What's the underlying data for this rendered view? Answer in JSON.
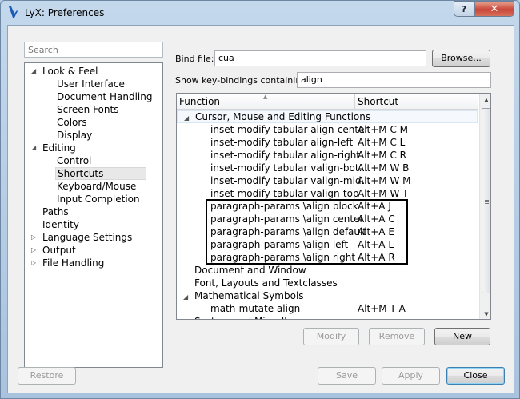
{
  "window": {
    "title": "LyX: Preferences",
    "help_glyph": "?",
    "close_glyph": "✕"
  },
  "search": {
    "placeholder": "Search"
  },
  "tree": [
    {
      "label": "Look & Feel",
      "level": 0,
      "expanded": true
    },
    {
      "label": "User Interface",
      "level": 1
    },
    {
      "label": "Document Handling",
      "level": 1
    },
    {
      "label": "Screen Fonts",
      "level": 1
    },
    {
      "label": "Colors",
      "level": 1
    },
    {
      "label": "Display",
      "level": 1
    },
    {
      "label": "Editing",
      "level": 0,
      "expanded": true
    },
    {
      "label": "Control",
      "level": 1
    },
    {
      "label": "Shortcuts",
      "level": 1,
      "selected": true
    },
    {
      "label": "Keyboard/Mouse",
      "level": 1
    },
    {
      "label": "Input Completion",
      "level": 1
    },
    {
      "label": "Paths",
      "level": 0
    },
    {
      "label": "Identity",
      "level": 0
    },
    {
      "label": "Language Settings",
      "level": 0,
      "collapsed": true
    },
    {
      "label": "Output",
      "level": 0,
      "collapsed": true
    },
    {
      "label": "File Handling",
      "level": 0,
      "collapsed": true
    }
  ],
  "bind_file": {
    "label": "Bind file:",
    "value": "cua",
    "browse_label": "Browse..."
  },
  "filter": {
    "label": "Show key-bindings containing:",
    "value": "align"
  },
  "table": {
    "columns": [
      "Function",
      "Shortcut"
    ],
    "rows": [
      {
        "fn": "Cursor, Mouse and Editing Functions",
        "sc": "",
        "level": 0,
        "expanded": true,
        "hl": true
      },
      {
        "fn": "inset-modify tabular align-center",
        "sc": "Alt+M C M",
        "level": 1
      },
      {
        "fn": "inset-modify tabular align-left",
        "sc": "Alt+M C L",
        "level": 1
      },
      {
        "fn": "inset-modify tabular align-right",
        "sc": "Alt+M C R",
        "level": 1
      },
      {
        "fn": "inset-modify tabular valign-bot...",
        "sc": "Alt+M W B",
        "level": 1
      },
      {
        "fn": "inset-modify tabular valign-mid...",
        "sc": "Alt+M W M",
        "level": 1
      },
      {
        "fn": "inset-modify tabular valign-top",
        "sc": "Alt+M W T",
        "level": 1
      },
      {
        "fn": "paragraph-params \\align block",
        "sc": "Alt+A J",
        "level": 1
      },
      {
        "fn": "paragraph-params \\align center",
        "sc": "Alt+A C",
        "level": 1
      },
      {
        "fn": "paragraph-params \\align default",
        "sc": "Alt+A E",
        "level": 1
      },
      {
        "fn": "paragraph-params \\align left",
        "sc": "Alt+A L",
        "level": 1
      },
      {
        "fn": "paragraph-params \\align right",
        "sc": "Alt+A R",
        "level": 1
      },
      {
        "fn": "Document and Window",
        "sc": "",
        "level": 0
      },
      {
        "fn": "Font, Layouts and Textclasses",
        "sc": "",
        "level": 0
      },
      {
        "fn": "Mathematical Symbols",
        "sc": "",
        "level": 0,
        "expanded": true
      },
      {
        "fn": "math-mutate align",
        "sc": "Alt+M T A",
        "level": 1
      },
      {
        "fn": "System and Miscellaneous",
        "sc": "",
        "level": 0
      }
    ]
  },
  "buttons": {
    "modify": "Modify",
    "remove": "Remove",
    "new": "New",
    "restore": "Restore",
    "save": "Save",
    "apply": "Apply",
    "close": "Close"
  },
  "colors": {
    "title_bar": "#b8cfe5",
    "close_button": "#c9473a",
    "highlight_border": "#000000"
  }
}
